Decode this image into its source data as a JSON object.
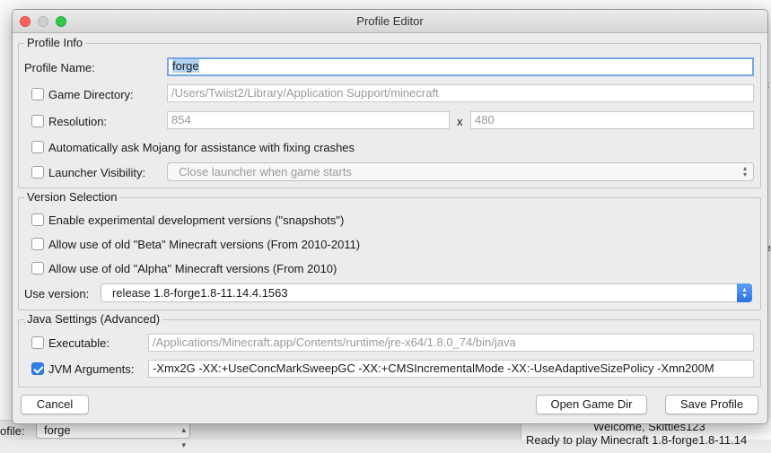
{
  "dialog": {
    "title": "Profile Editor"
  },
  "profile_info": {
    "legend": "Profile Info",
    "profile_name_label": "Profile Name:",
    "profile_name_value": "forge",
    "game_directory_label": "Game Directory:",
    "game_directory_value": "/Users/Twiist2/Library/Application Support/minecraft",
    "resolution_label": "Resolution:",
    "resolution_width": "854",
    "resolution_x": "x",
    "resolution_height": "480",
    "mojang_assist_label": "Automatically ask Mojang for assistance with fixing crashes",
    "launcher_visibility_label": "Launcher Visibility:",
    "launcher_visibility_value": "Close launcher when game starts"
  },
  "version_selection": {
    "legend": "Version Selection",
    "snapshots_label": "Enable experimental development versions (\"snapshots\")",
    "beta_label": "Allow use of old \"Beta\" Minecraft versions (From 2010-2011)",
    "alpha_label": "Allow use of old \"Alpha\" Minecraft versions (From 2010)",
    "use_version_label": "Use version:",
    "use_version_value": "release 1.8-forge1.8-11.14.4.1563"
  },
  "java_settings": {
    "legend": "Java Settings (Advanced)",
    "executable_label": "Executable:",
    "executable_value": "/Applications/Minecraft.app/Contents/runtime/jre-x64/1.8.0_74/bin/java",
    "jvm_label": "JVM Arguments:",
    "jvm_value": "-Xmx2G -XX:+UseConcMarkSweepGC -XX:+CMSIncrementalMode -XX:-UseAdaptiveSizePolicy -Xmn200M",
    "jvm_checked": true
  },
  "buttons": {
    "cancel": "Cancel",
    "open_game_dir": "Open Game Dir",
    "save_profile": "Save Profile"
  },
  "background": {
    "profile_label": "ofile:",
    "profile_value": "forge",
    "welcome": "Welcome, Skittles123",
    "ready": "Ready to play Minecraft 1.8-forge1.8-11.14"
  },
  "colors": {
    "accent": "#2f7fe6",
    "focus_ring": "#76a7e6"
  }
}
